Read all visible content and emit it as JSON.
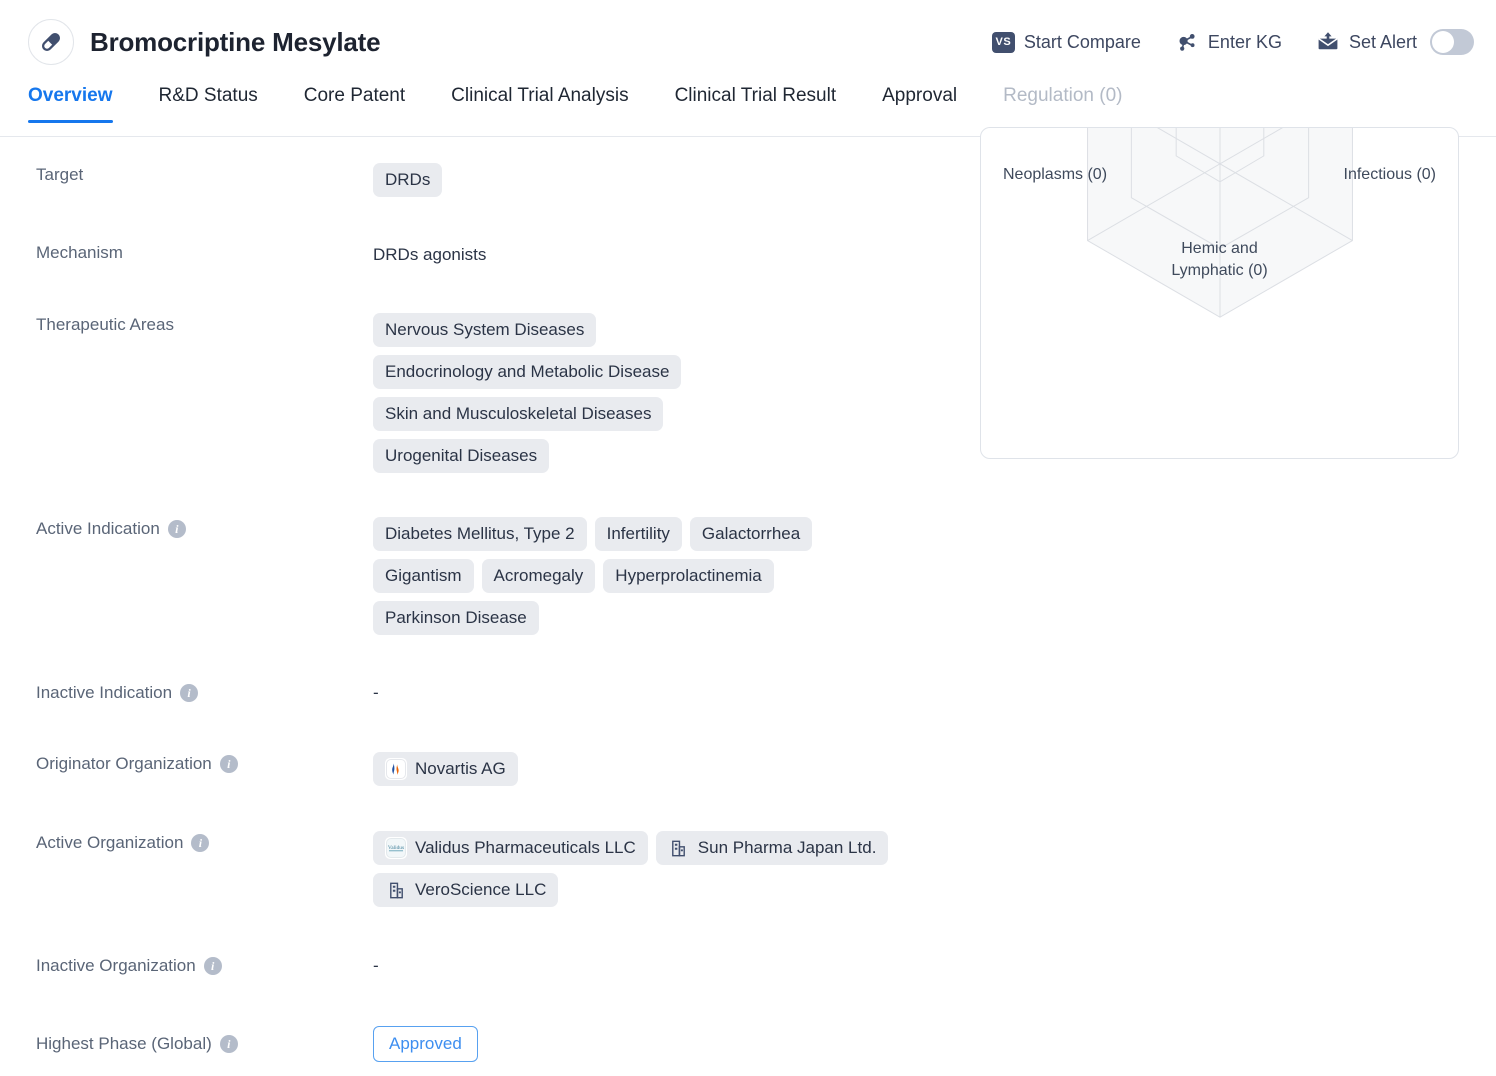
{
  "header": {
    "icon": "pill-capsule-icon",
    "title": "Bromocriptine Mesylate",
    "actions": {
      "compare_badge": "VS",
      "compare_label": "Start Compare",
      "kg_label": "Enter KG",
      "alert_label": "Set Alert",
      "alert_toggle_state": "off"
    }
  },
  "tabs": [
    {
      "label": "Overview",
      "state": "active"
    },
    {
      "label": "R&D Status",
      "state": "default"
    },
    {
      "label": "Core Patent",
      "state": "default"
    },
    {
      "label": "Clinical Trial Analysis",
      "state": "default"
    },
    {
      "label": "Clinical Trial Result",
      "state": "default"
    },
    {
      "label": "Approval",
      "state": "default"
    },
    {
      "label": "Regulation (0)",
      "state": "disabled"
    }
  ],
  "fields": {
    "target": {
      "label": "Target",
      "chips": [
        "DRDs"
      ]
    },
    "mechanism": {
      "label": "Mechanism",
      "value": "DRDs agonists"
    },
    "therapeutic_areas": {
      "label": "Therapeutic Areas",
      "chips": [
        "Nervous System Diseases",
        "Endocrinology and Metabolic Disease",
        "Skin and Musculoskeletal Diseases",
        "Urogenital Diseases"
      ]
    },
    "active_indication": {
      "label": "Active Indication",
      "chips": [
        "Diabetes Mellitus, Type 2",
        "Infertility",
        "Galactorrhea",
        "Gigantism",
        "Acromegaly",
        "Hyperprolactinemia",
        "Parkinson Disease"
      ]
    },
    "inactive_indication": {
      "label": "Inactive Indication",
      "value": "-"
    },
    "originator_organization": {
      "label": "Originator Organization",
      "orgs": [
        {
          "name": "Novartis AG",
          "logo": "novartis-flame-logo"
        }
      ]
    },
    "active_organization": {
      "label": "Active Organization",
      "orgs": [
        {
          "name": "Validus Pharmaceuticals LLC",
          "logo": "validus-wordmark-logo"
        },
        {
          "name": "Sun Pharma Japan Ltd.",
          "logo": "building-icon"
        },
        {
          "name": "VeroScience LLC",
          "logo": "building-icon"
        }
      ]
    },
    "inactive_organization": {
      "label": "Inactive Organization",
      "value": "-"
    },
    "highest_phase": {
      "label": "Highest Phase (Global)",
      "value": "Approved"
    }
  },
  "chart_data": {
    "type": "radar",
    "title": "",
    "note": "Partially visible radar/polygon chart; only bottom vertex and lower axis labels are in frame",
    "categories": [
      "Neoplasms",
      "Infectious",
      "Hemic and Lymphatic"
    ],
    "values": [
      0,
      0,
      0
    ],
    "tick_labels": [
      "Neoplasms (0)",
      "Infectious (0)",
      "Hemic and\nLymphatic (0)"
    ],
    "labels": {
      "neoplasms": "Neoplasms (0)",
      "infectious": "Infectious (0)",
      "hemic_line1": "Hemic and",
      "hemic_line2": "Lymphatic (0)"
    },
    "grid": true,
    "rings": 3,
    "legend_position": "none"
  },
  "colors": {
    "accent": "#1677ed",
    "chip_bg": "#e9ebef",
    "label_text": "#5a6577",
    "value_text": "#2b3446",
    "icon_navy": "#414f6e",
    "approved_border": "#58a1f0",
    "approved_text": "#3d8ef0",
    "panel_border": "#dfe3e9"
  }
}
